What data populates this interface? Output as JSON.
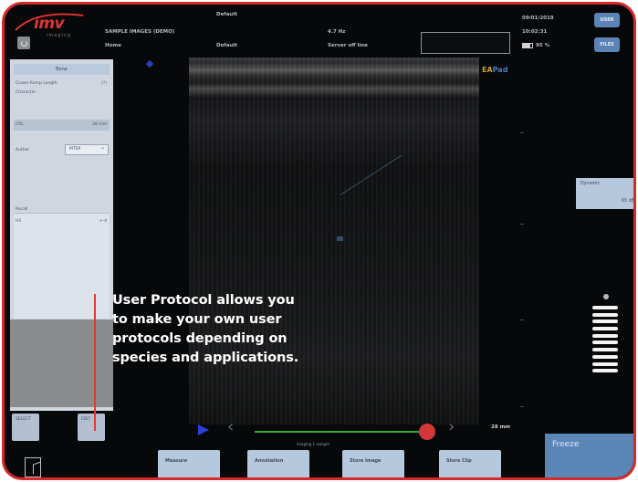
{
  "header": {
    "brand": "imv",
    "brand_sub": "imaging",
    "preset_top": "Default",
    "patient": "SAMPLE IMAGES (DEMO)",
    "operator": "Home",
    "preset": "Default",
    "frequency": "4.7 Hz",
    "server_status": "Server off line",
    "date": "09/01/2019",
    "time": "10:02:31",
    "battery_pct": "95 %",
    "user_button": "USER",
    "files_button": "FILES"
  },
  "left_panel": {
    "title": "Bone",
    "rows": [
      {
        "label": "Crown-Rump Length",
        "value": "(?)"
      },
      {
        "label": "Character",
        "value": ""
      }
    ],
    "crl_label": "CRL",
    "crl_value": "28 mm",
    "author_label": "Author",
    "author_value": "MTSP",
    "recall_label": "Recall",
    "list_item_label": "HS",
    "list_item_value": "+-4",
    "select_button": "SELECT",
    "edit_button": "EDIT"
  },
  "image": {
    "probe_label_a": "EA",
    "probe_label_b": "Pad",
    "depth": "28 mm",
    "cine_caption": "imaging 1 sample"
  },
  "right_panel": {
    "dynamic_label": "Dynamic",
    "dynamic_value": "65 dB"
  },
  "toolbar": {
    "measure": "Measure",
    "annotation": "Annotation",
    "store_image": "Store Image",
    "store_clip": "Store Clip",
    "freeze": "Freeze"
  },
  "annotation": {
    "line1": "User Protocol allows you",
    "line2": "to make your own user",
    "line3": "protocols depending on",
    "line4": "species and applications."
  }
}
